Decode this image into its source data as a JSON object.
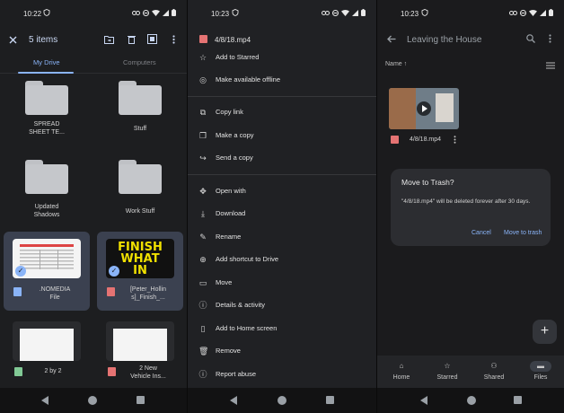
{
  "left": {
    "time": "10:22",
    "selection_label": "5 items",
    "tabs": [
      "My Drive",
      "Computers"
    ],
    "folders": [
      {
        "label_line1": "SPREAD",
        "label_line2": "SHEET TE..."
      },
      {
        "label_line1": "Stuff",
        "label_line2": ""
      },
      {
        "label_line1": "Updated",
        "label_line2": "Shadows"
      },
      {
        "label_line1": "Work Stuff",
        "label_line2": ""
      }
    ],
    "files": [
      {
        "label_line1": ".NOMEDIA",
        "label_line2": "File"
      },
      {
        "label_line1": "[Peter_Hollin",
        "label_line2": "s]_Finish_..."
      },
      {
        "label_line1": "2 by 2",
        "label_line2": ""
      },
      {
        "label_line1": "2 New",
        "label_line2": "Vehicle Ins..."
      }
    ],
    "thumb_text": [
      "FINISH",
      "WHAT",
      "IN"
    ]
  },
  "middle": {
    "time": "10:23",
    "file_name": "4/8/18.mp4",
    "menu": [
      "Add to Starred",
      "Make available offline",
      "Copy link",
      "Make a copy",
      "Send a copy",
      "Open with",
      "Download",
      "Rename",
      "Add shortcut to Drive",
      "Move",
      "Details & activity",
      "Add to Home screen",
      "Remove",
      "Report abuse"
    ]
  },
  "right": {
    "time": "10:23",
    "folder_title": "Leaving the House",
    "sort_label": "Name",
    "file_name": "4/8/18.mp4",
    "dialog": {
      "title": "Move to Trash?",
      "message": "\"4/8/18.mp4\" will be deleted forever after 30 days.",
      "cancel": "Cancel",
      "confirm": "Move to trash"
    },
    "nav": [
      "Home",
      "Starred",
      "Shared",
      "Files"
    ]
  },
  "colors": {
    "accent": "#8ab4f8",
    "selected_tile": "#3b4150",
    "background": "#1d1e20"
  }
}
